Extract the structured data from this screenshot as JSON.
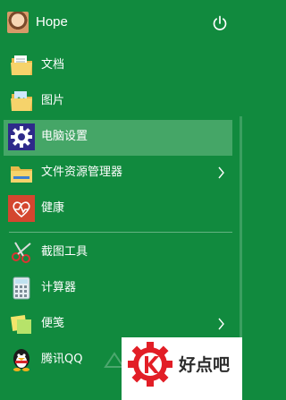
{
  "user": {
    "name": "Hope",
    "avatar_icon": "user-avatar",
    "power_icon": "power-icon"
  },
  "items": [
    {
      "label": "文档",
      "icon": "folder-documents-icon",
      "has_submenu": false,
      "active": false
    },
    {
      "label": "图片",
      "icon": "folder-pictures-icon",
      "has_submenu": false,
      "active": false
    },
    {
      "label": "电脑设置",
      "icon": "gear-icon",
      "has_submenu": false,
      "active": true
    },
    {
      "label": "文件资源管理器",
      "icon": "file-explorer-icon",
      "has_submenu": true,
      "active": false
    },
    {
      "label": "健康",
      "icon": "health-heart-icon",
      "has_submenu": false,
      "active": false
    },
    {
      "label": "截图工具",
      "icon": "scissors-icon",
      "has_submenu": false,
      "active": false
    },
    {
      "label": "计算器",
      "icon": "calculator-icon",
      "has_submenu": false,
      "active": false
    },
    {
      "label": "便笺",
      "icon": "sticky-notes-icon",
      "has_submenu": true,
      "active": false
    },
    {
      "label": "腾讯QQ",
      "icon": "qq-penguin-icon",
      "has_submenu": false,
      "active": false
    }
  ],
  "watermark": {
    "text": "好点吧"
  },
  "colors": {
    "background": "#118a3e",
    "active": "#45a667",
    "text": "#ffffff"
  }
}
